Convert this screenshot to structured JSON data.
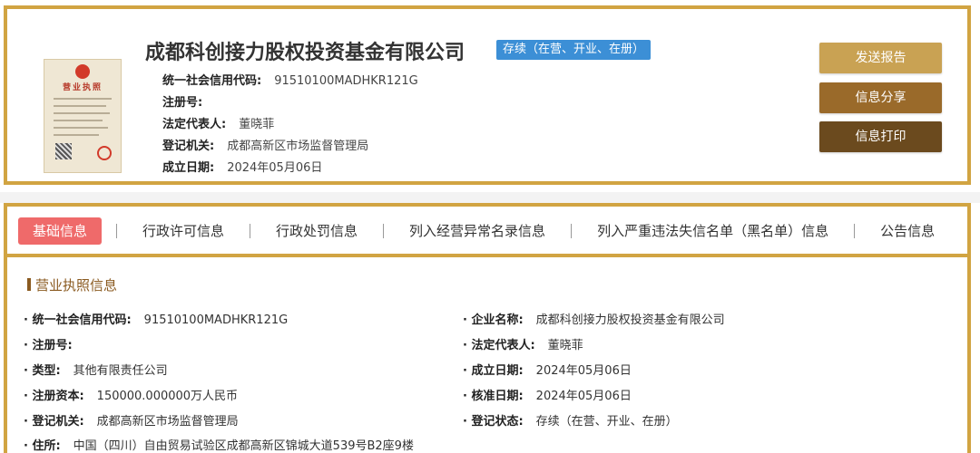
{
  "header": {
    "company_name": "成都科创接力股权投资基金有限公司",
    "status_badge": "存续（在营、开业、在册）",
    "license_title": "营业执照",
    "rows": [
      {
        "label": "统一社会信用代码:",
        "value": "91510100MADHKR121G"
      },
      {
        "label": "注册号:",
        "value": ""
      },
      {
        "label": "法定代表人:",
        "value": "董晓菲"
      },
      {
        "label": "登记机关:",
        "value": "成都高新区市场监督管理局"
      },
      {
        "label": "成立日期:",
        "value": "2024年05月06日"
      }
    ],
    "buttons": {
      "send_report": "发送报告",
      "share": "信息分享",
      "print": "信息打印"
    }
  },
  "tabs": [
    {
      "label": "基础信息"
    },
    {
      "label": "行政许可信息"
    },
    {
      "label": "行政处罚信息"
    },
    {
      "label": "列入经营异常名录信息"
    },
    {
      "label": "列入严重违法失信名单（黑名单）信息"
    },
    {
      "label": "公告信息"
    }
  ],
  "section": {
    "title": "营业执照信息",
    "left": [
      {
        "label": "· 统一社会信用代码:",
        "value": "91510100MADHKR121G"
      },
      {
        "label": "· 注册号:",
        "value": ""
      },
      {
        "label": "· 类型:",
        "value": "其他有限责任公司"
      },
      {
        "label": "· 注册资本:",
        "value": "150000.000000万人民币"
      },
      {
        "label": "· 登记机关:",
        "value": "成都高新区市场监督管理局"
      },
      {
        "label": "· 住所:",
        "value": "中国（四川）自由贸易试验区成都高新区锦城大道539号B2座9楼"
      }
    ],
    "right": [
      {
        "label": "· 企业名称:",
        "value": "成都科创接力股权投资基金有限公司"
      },
      {
        "label": "· 法定代表人:",
        "value": "董晓菲"
      },
      {
        "label": "· 成立日期:",
        "value": "2024年05月06日"
      },
      {
        "label": "· 核准日期:",
        "value": "2024年05月06日"
      },
      {
        "label": "· 登记状态:",
        "value": "存续（在营、开业、在册）"
      }
    ]
  },
  "colors": {
    "border": "#d1a442",
    "btn_send": "#c9a253",
    "btn_share": "#9a6a2a",
    "btn_print": "#6b4a1e",
    "active_tab": "#ef6a6a",
    "status_badge": "#3c8fd6",
    "section_title": "#8a5a20"
  }
}
